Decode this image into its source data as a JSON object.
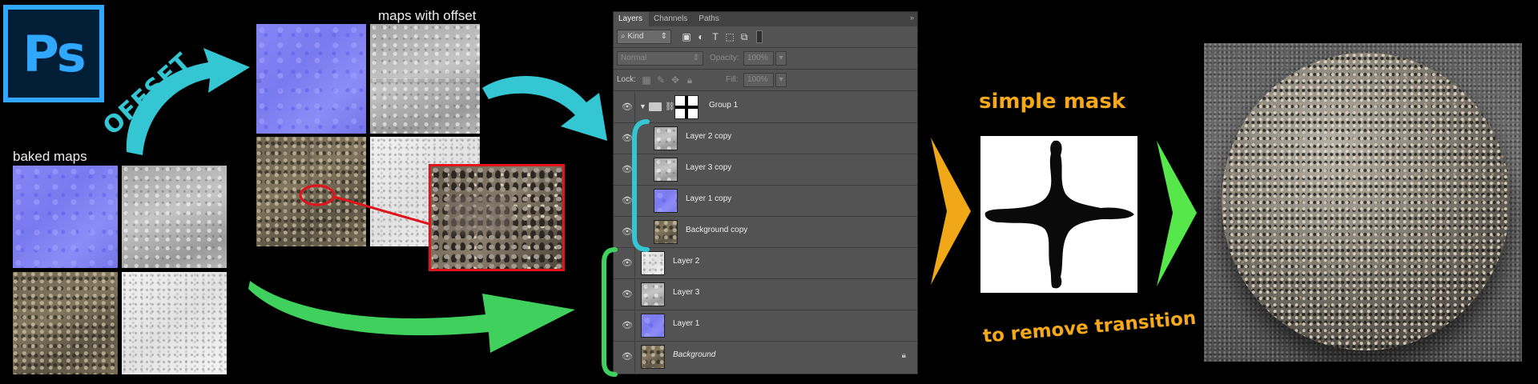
{
  "logo": {
    "text": "Ps"
  },
  "labels": {
    "offset": "OFFSET",
    "baked_maps": "baked maps",
    "maps_with_offset": "maps with offset",
    "simple_mask": "simple mask",
    "to_remove_transition": "to remove transition"
  },
  "panel": {
    "tabs": [
      "Layers",
      "Channels",
      "Paths"
    ],
    "filter": {
      "search_icon": "search-icon",
      "value": "Kind"
    },
    "blend_mode": "Normal",
    "opacity_label": "Opacity:",
    "opacity_value": "100%",
    "lock_label": "Lock:",
    "fill_label": "Fill:",
    "fill_value": "100%",
    "layers": [
      {
        "name": "Group 1",
        "type": "group",
        "thumb": "mask"
      },
      {
        "name": "Layer 2 copy",
        "type": "child",
        "thumb": "gray"
      },
      {
        "name": "Layer 3 copy",
        "type": "child",
        "thumb": "gray"
      },
      {
        "name": "Layer 1 copy",
        "type": "child",
        "thumb": "normal"
      },
      {
        "name": "Background copy",
        "type": "child",
        "thumb": "dirt"
      },
      {
        "name": "Layer 2",
        "type": "layer",
        "thumb": "white"
      },
      {
        "name": "Layer 3",
        "type": "layer",
        "thumb": "gray"
      },
      {
        "name": "Layer 1",
        "type": "layer",
        "thumb": "normal"
      },
      {
        "name": "Background",
        "type": "background",
        "thumb": "dirt"
      }
    ]
  },
  "colors": {
    "cyan_arrow": "#35c6d3",
    "green_arrow": "#3fd05e",
    "orange_chevron": "#f0a818",
    "green_chevron": "#56e84a",
    "highlight_red": "#e0141a",
    "ps_blue": "#31a8ff"
  }
}
